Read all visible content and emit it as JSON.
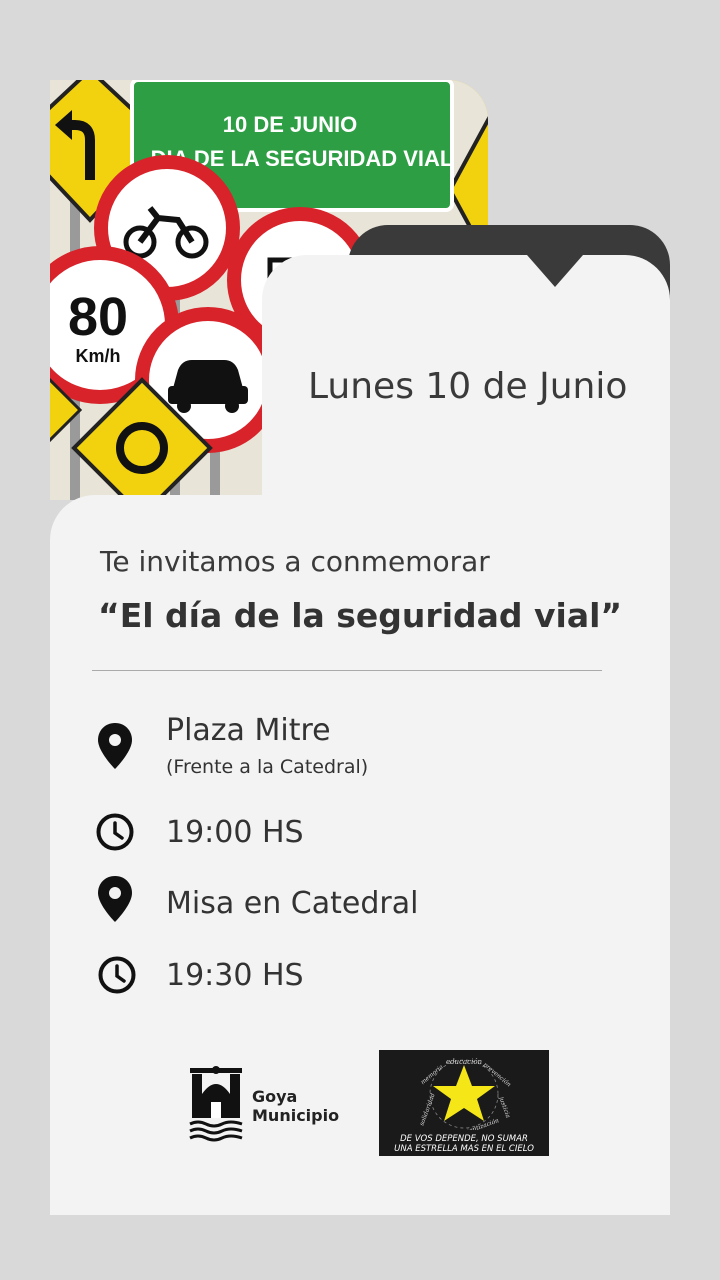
{
  "photo": {
    "sign_line1": "10 DE JUNIO",
    "sign_line2": "DIA DE LA SEGURIDAD VIAL",
    "speed_number": "80",
    "speed_unit": "Km/h"
  },
  "event": {
    "date": "Lunes 10 de Junio",
    "invite": "Te invitamos a conmemorar",
    "title": "“El día de la seguridad vial”"
  },
  "details": [
    {
      "icon": "location-pin-icon",
      "text": "Plaza Mitre",
      "sub": "(Frente a la Catedral)"
    },
    {
      "icon": "clock-icon",
      "text": "19:00 HS"
    },
    {
      "icon": "location-pin-icon",
      "text": "Misa en Catedral"
    },
    {
      "icon": "clock-icon",
      "text": "19:30 HS"
    }
  ],
  "logos": {
    "goya_line1": "Goya",
    "goya_line2": "Municipio",
    "star_caption1": "DE VOS DEPENDE, NO SUMAR",
    "star_caption2": "UNA ESTRELLA MAS EN EL CIELO",
    "star_ring": [
      "memoria",
      "educación",
      "prevención",
      "justicia",
      "concientización",
      "solidaridad"
    ]
  },
  "colors": {
    "background": "#d9d9d9",
    "card": "#f3f3f3",
    "dark_tab": "#3a3a3a",
    "sign_green": "#2e9e45",
    "sign_yellow": "#f2d20f",
    "sign_red": "#d8232a",
    "star": "#f5e617"
  }
}
